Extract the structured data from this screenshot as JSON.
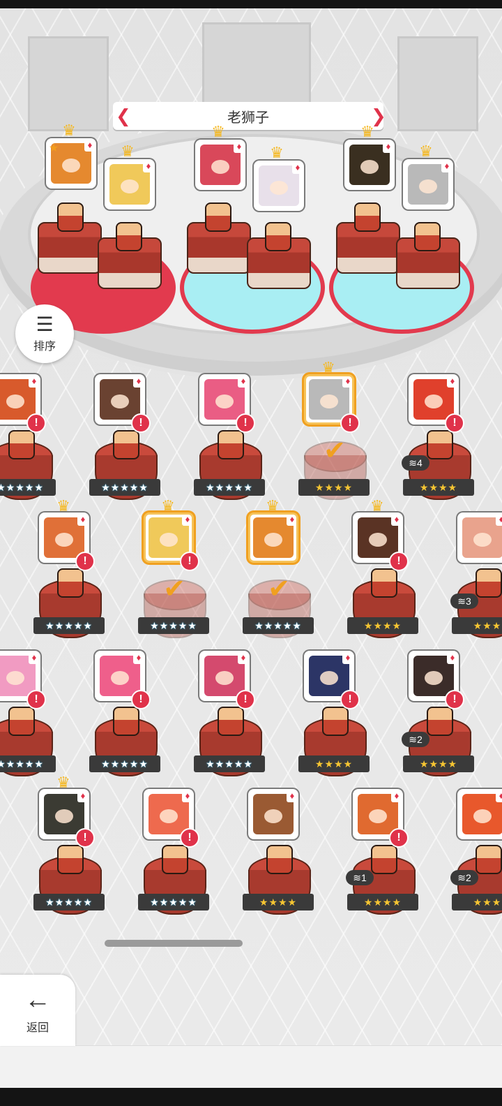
{
  "title": "老狮子",
  "sort_button": {
    "label": "排序",
    "icon": "sort-icon"
  },
  "back_button": {
    "label": "返回",
    "icon": "arrow-left-icon"
  },
  "colors": {
    "accent_red": "#e0324a",
    "gold": "#f4b823",
    "select_orange": "#f0a020"
  },
  "team_slots": [
    {
      "crown": true,
      "portrait_color": "#e5892f"
    },
    {
      "crown": true,
      "portrait_color": "#f0c95a"
    },
    {
      "crown": true,
      "portrait_color": "#d9485a"
    },
    {
      "crown": true,
      "portrait_color": "#e8e0ea"
    },
    {
      "crown": true,
      "portrait_color": "#3a2f20"
    },
    {
      "crown": true,
      "portrait_color": "#b9b9b9"
    }
  ],
  "roster": [
    {
      "stars": "★★★★★",
      "color": "#d85a2c",
      "alert": "!",
      "crown": false,
      "selected": false,
      "dup": ""
    },
    {
      "stars": "★★★★★",
      "color": "#6a4231",
      "alert": "!",
      "crown": false,
      "selected": false,
      "dup": ""
    },
    {
      "stars": "★★★★★",
      "color": "#ea5d84",
      "alert": "!",
      "crown": false,
      "selected": false,
      "dup": ""
    },
    {
      "stars": "★★★★",
      "color": "#b9b9b9",
      "alert": "!",
      "crown": true,
      "selected": true,
      "dup": ""
    },
    {
      "stars": "★★★★",
      "color": "#e0402c",
      "alert": "!",
      "crown": false,
      "selected": false,
      "dup": "4"
    },
    {
      "stars": "★★★★★",
      "color": "#e07038",
      "alert": "!",
      "crown": true,
      "selected": false,
      "dup": ""
    },
    {
      "stars": "★★★★★",
      "color": "#f0c95a",
      "alert": "!",
      "crown": true,
      "selected": true,
      "dup": ""
    },
    {
      "stars": "★★★★★",
      "color": "#e5892f",
      "alert": "",
      "crown": true,
      "selected": true,
      "dup": ""
    },
    {
      "stars": "★★★★",
      "color": "#5a3324",
      "alert": "!",
      "crown": true,
      "selected": false,
      "dup": ""
    },
    {
      "stars": "★★★",
      "color": "#e9a38d",
      "alert": "",
      "crown": false,
      "selected": false,
      "dup": "3"
    },
    {
      "stars": "★★★★★",
      "color": "#f19bc2",
      "alert": "!",
      "crown": false,
      "selected": false,
      "dup": ""
    },
    {
      "stars": "★★★★★",
      "color": "#ef5f8b",
      "alert": "!",
      "crown": false,
      "selected": false,
      "dup": ""
    },
    {
      "stars": "★★★★★",
      "color": "#d44a6e",
      "alert": "!",
      "crown": false,
      "selected": false,
      "dup": ""
    },
    {
      "stars": "★★★★",
      "color": "#2c3566",
      "alert": "!",
      "crown": false,
      "selected": false,
      "dup": ""
    },
    {
      "stars": "★★★★",
      "color": "#3b2c29",
      "alert": "!",
      "crown": false,
      "selected": false,
      "dup": "2"
    },
    {
      "stars": "★★★★★",
      "color": "#3b3b33",
      "alert": "!",
      "crown": true,
      "selected": false,
      "dup": ""
    },
    {
      "stars": "★★★★★",
      "color": "#ee6a4e",
      "alert": "!",
      "crown": false,
      "selected": false,
      "dup": ""
    },
    {
      "stars": "★★★★",
      "color": "#9a5a33",
      "alert": "",
      "crown": false,
      "selected": false,
      "dup": ""
    },
    {
      "stars": "★★★★",
      "color": "#e06a30",
      "alert": "!",
      "crown": false,
      "selected": false,
      "dup": "1"
    },
    {
      "stars": "★★★",
      "color": "#e8582c",
      "alert": "",
      "crown": false,
      "selected": false,
      "dup": "2"
    }
  ]
}
